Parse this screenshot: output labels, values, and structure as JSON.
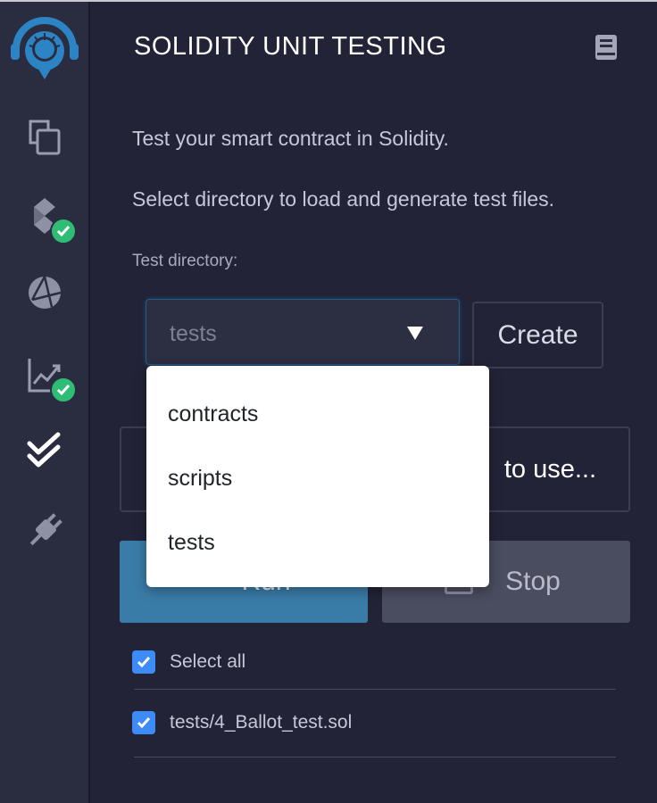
{
  "sidebar": {
    "items": [
      {
        "name": "remix-logo-icon"
      },
      {
        "name": "file-explorer-icon"
      },
      {
        "name": "solidity-compiler-icon",
        "badge": "check"
      },
      {
        "name": "deploy-run-icon"
      },
      {
        "name": "analysis-icon",
        "badge": "check"
      },
      {
        "name": "unit-testing-icon",
        "active": true
      },
      {
        "name": "plugin-manager-icon"
      }
    ]
  },
  "header": {
    "title": "SOLIDITY UNIT TESTING"
  },
  "description": {
    "line1": "Test your smart contract in Solidity.",
    "line2": "Select directory to load and generate test files."
  },
  "test_directory": {
    "label": "Test directory:",
    "selected": "tests",
    "create_label": "Create",
    "options": [
      "contracts",
      "scripts",
      "tests"
    ]
  },
  "generate": {
    "visible_text": "to use..."
  },
  "actions": {
    "run_label": "Run",
    "stop_label": "Stop"
  },
  "files": {
    "select_all_label": "Select all",
    "items": [
      {
        "name": "tests/4_Ballot_test.sol",
        "checked": true
      }
    ]
  },
  "colors": {
    "background": "#222336",
    "rail": "#2a2c3f",
    "accent_run": "#3a7ca8",
    "check": "#3d8bf7",
    "badge": "#2fbd75",
    "logo": "#2d84c4"
  }
}
